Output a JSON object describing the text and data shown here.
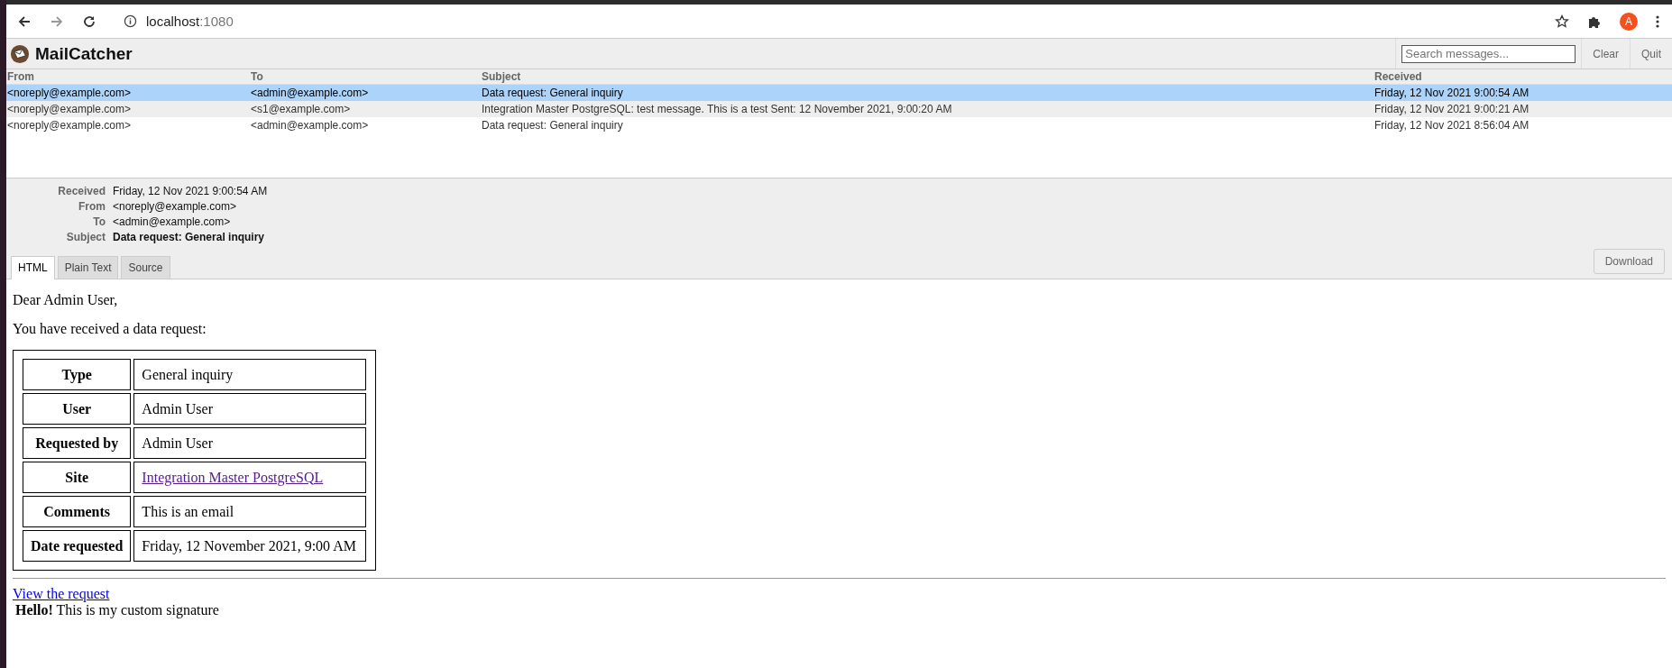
{
  "browser": {
    "url_host": "localhost",
    "url_port": ":1080",
    "profile_initial": "A"
  },
  "app": {
    "title": "MailCatcher",
    "search": {
      "placeholder": "Search messages..."
    },
    "buttons": [
      "Clear",
      "Quit"
    ]
  },
  "messages": {
    "columns": [
      "From",
      "To",
      "Subject",
      "Received"
    ],
    "rows": [
      {
        "from": "<noreply@example.com>",
        "to": "<admin@example.com>",
        "subject": "Data request: General inquiry",
        "received": "Friday, 12 Nov 2021 9:00:54 AM",
        "selected": true
      },
      {
        "from": "<noreply@example.com>",
        "to": "<s1@example.com>",
        "subject": "Integration Master PostgreSQL: test message. This is a test Sent: 12 November 2021, 9:00:20 AM",
        "received": "Friday, 12 Nov 2021 9:00:21 AM",
        "selected": false
      },
      {
        "from": "<noreply@example.com>",
        "to": "<admin@example.com>",
        "subject": "Data request: General inquiry",
        "received": "Friday, 12 Nov 2021 8:56:04 AM",
        "selected": false
      }
    ]
  },
  "detail": {
    "fields": [
      {
        "label": "Received",
        "value": "Friday, 12 Nov 2021 9:00:54 AM",
        "bold": false
      },
      {
        "label": "From",
        "value": "<noreply@example.com>",
        "bold": false
      },
      {
        "label": "To",
        "value": "<admin@example.com>",
        "bold": false
      },
      {
        "label": "Subject",
        "value": "Data request: General inquiry",
        "bold": true
      }
    ],
    "tabs": [
      {
        "label": "HTML",
        "selected": true
      },
      {
        "label": "Plain Text",
        "selected": false
      },
      {
        "label": "Source",
        "selected": false
      }
    ],
    "download": "Download"
  },
  "body": {
    "greeting": "Dear Admin User,",
    "intro": "You have received a data request:",
    "table": [
      {
        "label": "Type",
        "value": "General inquiry",
        "kind": "text"
      },
      {
        "label": "User",
        "value": "Admin User",
        "kind": "text"
      },
      {
        "label": "Requested by",
        "value": "Admin User",
        "kind": "text"
      },
      {
        "label": "Site",
        "value": "Integration Master PostgreSQL",
        "kind": "link",
        "visited": true
      },
      {
        "label": "Comments",
        "value": "This is an email",
        "kind": "text"
      },
      {
        "label": "Date requested",
        "value": "Friday, 12 November 2021, 9:00 AM",
        "kind": "text"
      }
    ],
    "link": {
      "label": "View the request",
      "visited": false
    },
    "signature": "**Hello!** This is my custom signature"
  }
}
